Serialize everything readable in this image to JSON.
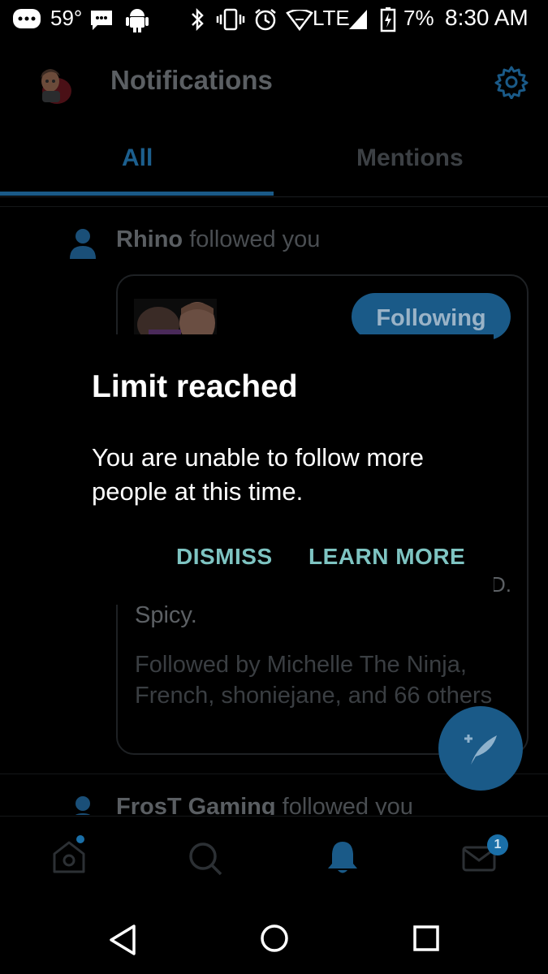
{
  "status_bar": {
    "temperature": "59°",
    "network": "LTE",
    "battery": "7%",
    "time": "8:30 AM"
  },
  "header": {
    "title": "Notifications"
  },
  "tabs": [
    {
      "label": "All",
      "active": true
    },
    {
      "label": "Mentions",
      "active": false
    }
  ],
  "notifications": [
    {
      "user": "Rhino",
      "action": "followed you",
      "card": {
        "follow_label": "Following",
        "bio_fragment": "Spicy.",
        "bio_cut": "D.",
        "followed_by": "Followed by Michelle The Ninja, French, shoniejane, and 66 others"
      }
    },
    {
      "user": "FrosT Gaming",
      "action": "followed you"
    }
  ],
  "dialog": {
    "title": "Limit reached",
    "message": "You are unable to follow more people at this time.",
    "dismiss_label": "DISMISS",
    "learn_more_label": "LEARN MORE"
  },
  "bottom_nav": {
    "items": [
      "home-icon",
      "search-icon",
      "notifications-bell-icon",
      "messages-envelope-icon"
    ],
    "messages_badge": "1"
  },
  "colors": {
    "accent": "#1da1f2",
    "dialog_button": "#7ec4c2"
  }
}
